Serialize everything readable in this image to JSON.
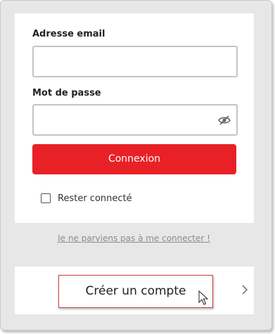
{
  "form": {
    "email_label": "Adresse email",
    "email_value": "",
    "password_label": "Mot de passe",
    "password_value": "",
    "login_button": "Connexion",
    "remember_label": "Rester connecté",
    "remember_checked": false
  },
  "links": {
    "forgot": "Je ne parviens pas à me connecter !"
  },
  "create_account": {
    "label": "Créer un compte"
  },
  "colors": {
    "accent": "#e82127",
    "background": "#e7e7e7",
    "highlight_border": "#c9393d"
  },
  "icons": {
    "password_toggle": "eye-slash-icon",
    "chevron": "chevron-right-icon",
    "cursor": "mouse-pointer-icon"
  }
}
